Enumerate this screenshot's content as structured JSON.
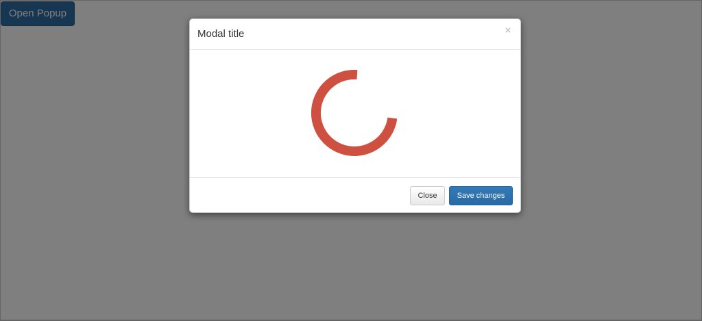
{
  "page": {
    "open_button_label": "Open Popup"
  },
  "modal": {
    "title": "Modal title",
    "close_glyph": "×",
    "loading": {
      "icon": "loading-spinner-icon",
      "color": "#cd5040"
    },
    "footer": {
      "close_label": "Close",
      "save_label": "Save changes"
    }
  },
  "colors": {
    "backdrop": "#808080",
    "primary": "#337ab7",
    "spinner": "#cd5040"
  }
}
